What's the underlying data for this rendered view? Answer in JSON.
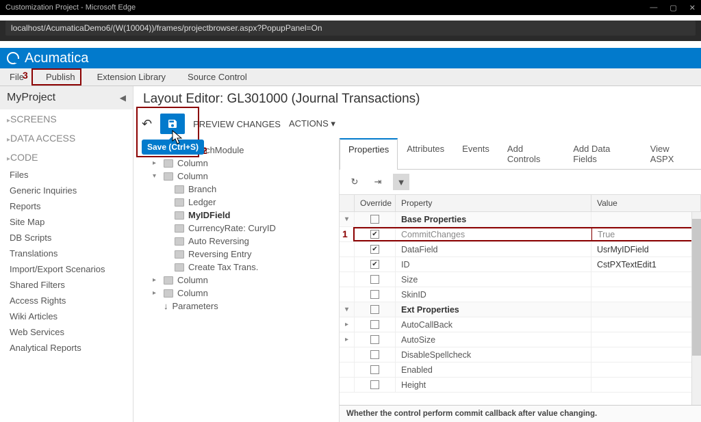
{
  "window": {
    "title": "Customization Project - Microsoft Edge"
  },
  "url": "localhost/AcumaticaDemo6/(W(10004))/frames/projectbrowser.aspx?PopupPanel=On",
  "brand": "Acumatica",
  "menubar": {
    "file": "File",
    "publish": "Publish",
    "extlib": "Extension Library",
    "srcctl": "Source Control"
  },
  "annot": {
    "a1": "1",
    "a2": "2",
    "a3": "3"
  },
  "sidebar": {
    "title": "MyProject",
    "groups": [
      "SCREENS",
      "DATA ACCESS",
      "CODE"
    ],
    "items": [
      "Files",
      "Generic Inquiries",
      "Reports",
      "Site Map",
      "DB Scripts",
      "Translations",
      "Import/Export Scenarios",
      "Shared Filters",
      "Access Rights",
      "Wiki Articles",
      "Web Services",
      "Analytical Reports"
    ]
  },
  "main": {
    "title": "Layout Editor: GL301000 (Journal Transactions)"
  },
  "toolbar": {
    "preview": "PREVIEW CHANGES",
    "actions": "ACTIONS",
    "tooltip": "Save (Ctrl+S)"
  },
  "tree": {
    "root": "Form: BatchModule",
    "n1": "Column",
    "n2": "Column",
    "n2a": "Branch",
    "n2b": "Ledger",
    "n2c": "MyIDField",
    "n2d": "CurrencyRate: CuryID",
    "n2e": "Auto Reversing",
    "n2f": "Reversing Entry",
    "n2g": "Create Tax Trans.",
    "n3": "Column",
    "n4": "Column",
    "n5": "Parameters"
  },
  "tabs": {
    "t1": "Properties",
    "t2": "Attributes",
    "t3": "Events",
    "t4": "Add Controls",
    "t5": "Add Data Fields",
    "t6": "View ASPX"
  },
  "gridhead": {
    "override": "Override",
    "property": "Property",
    "value": "Value"
  },
  "rows": {
    "base": "Base Properties",
    "r1p": "CommitChanges",
    "r1v": "True",
    "r2p": "DataField",
    "r2v": "UsrMyIDField",
    "r3p": "ID",
    "r3v": "CstPXTextEdit1",
    "r4p": "Size",
    "r5p": "SkinID",
    "ext": "Ext Properties",
    "r6p": "AutoCallBack",
    "r7p": "AutoSize",
    "r8p": "DisableSpellcheck",
    "r9p": "Enabled",
    "r10p": "Height"
  },
  "help": "Whether the control perform commit callback after value changing."
}
